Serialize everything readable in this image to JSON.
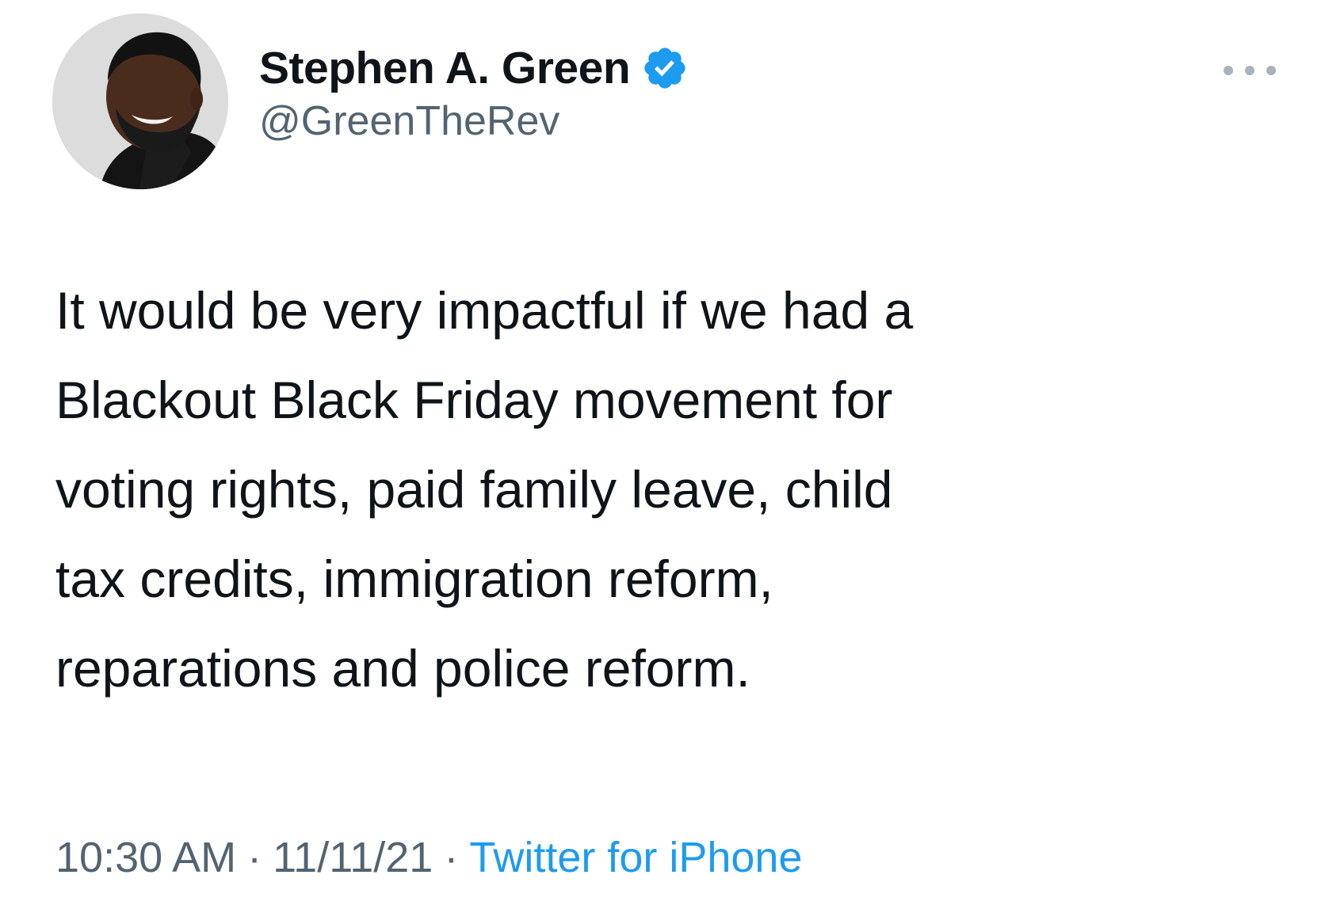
{
  "author": {
    "display_name": "Stephen A. Green",
    "handle": "@GreenTheRev",
    "verified_icon": "verified-badge-icon",
    "avatar_icon": "avatar-photo"
  },
  "tweet": {
    "lines": [
      "It would be very impactful if we had a",
      "Blackout Black Friday movement for",
      "voting rights, paid family leave, child",
      "tax credits, immigration reform,",
      "reparations and police reform."
    ]
  },
  "meta": {
    "time": "10:30 AM",
    "separator": "·",
    "date": "11/11/21",
    "source": "Twitter for iPhone"
  },
  "menu": {
    "icon": "more-options-icon"
  },
  "colors": {
    "text": "#0f1419",
    "secondary": "#536471",
    "link": "#1d9bf0",
    "verified": "#1d9bf0"
  }
}
